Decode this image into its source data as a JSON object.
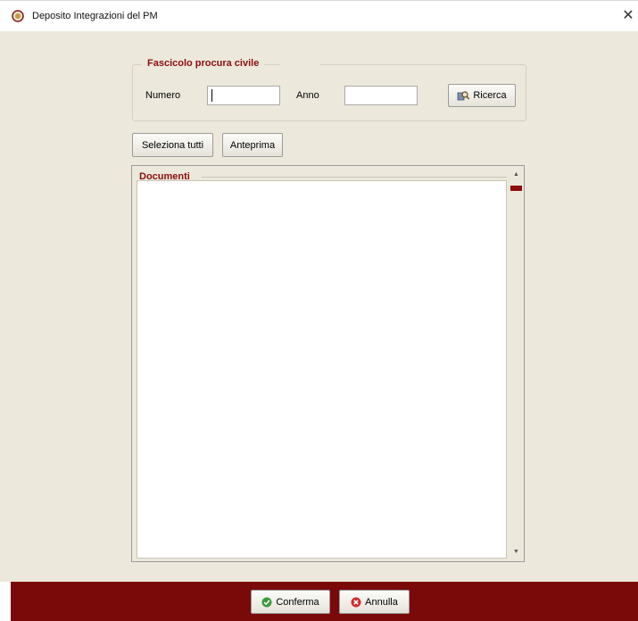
{
  "window": {
    "title": "Deposito Integrazioni del PM",
    "close_glyph": "✕"
  },
  "fascicolo": {
    "legend": "Fascicolo procura civile",
    "numero_label": "Numero",
    "numero_value": "",
    "anno_label": "Anno",
    "anno_value": "",
    "search_button": "Ricerca"
  },
  "toolbar": {
    "select_all": "Seleziona tutti",
    "preview": "Anteprima"
  },
  "documents": {
    "legend": "Documenti",
    "items": []
  },
  "footer": {
    "confirm": "Conferma",
    "cancel": "Annulla"
  },
  "colors": {
    "accent": "#8b0d0d",
    "footer_bg": "#7a0a0a",
    "client_bg": "#ece9dc"
  },
  "icons": {
    "app": "italian-emblem-icon",
    "search": "search-icon",
    "confirm": "check-circle-icon",
    "cancel": "x-circle-icon"
  }
}
